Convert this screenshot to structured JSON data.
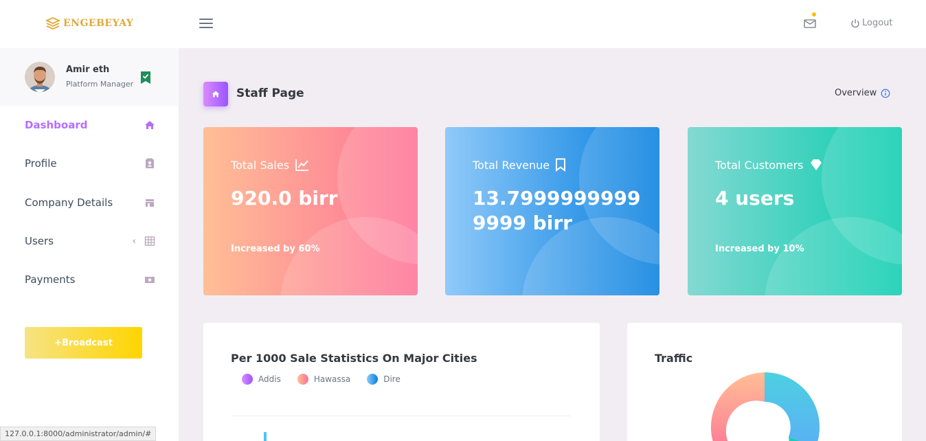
{
  "brand": {
    "name": "ENGEBEYAY",
    "color": "#e0a93a"
  },
  "navbar": {
    "logout_label": "Logout",
    "mail_icon": "mail-icon",
    "notification_dot_color": "#fcc000"
  },
  "sidebar": {
    "user": {
      "name": "Amir eth",
      "role": "Platform Manager"
    },
    "items": [
      {
        "label": "Dashboard",
        "icon": "home-icon",
        "active": true
      },
      {
        "label": "Profile",
        "icon": "contact-card-icon",
        "active": false
      },
      {
        "label": "Company Details",
        "icon": "store-icon",
        "active": false
      },
      {
        "label": "Users",
        "icon": "grid-icon",
        "active": false,
        "chevron": "‹"
      },
      {
        "label": "Payments",
        "icon": "cash-icon",
        "active": false
      }
    ],
    "broadcast_label": "+Broadcast"
  },
  "page": {
    "title": "Staff Page",
    "overview_label": "Overview"
  },
  "cards": [
    {
      "title": "Total Sales",
      "icon": "chart-line-icon",
      "value": "920.0 birr",
      "sub": "Increased by 60%"
    },
    {
      "title": "Total Revenue",
      "icon": "bookmark-icon",
      "value": "13.79999999999999 birr",
      "sub": ""
    },
    {
      "title": "Total Customers",
      "icon": "diamond-icon",
      "value": "4 users",
      "sub": "Increased by 10%"
    }
  ],
  "sales_panel": {
    "title": "Per 1000 Sale Statistics On Major Cities",
    "legend": [
      {
        "label": "Addis",
        "color": "#9a55ff"
      },
      {
        "label": "Hawassa",
        "color": "#fe7096"
      },
      {
        "label": "Dire",
        "color": "#4fa8f0"
      }
    ]
  },
  "traffic_panel": {
    "title": "Traffic",
    "colors": [
      "#fe7096",
      "#4fc3f7",
      "#07cdae"
    ]
  },
  "status_bar": {
    "url": "127.0.0.1:8000/administrator/admin/#"
  }
}
